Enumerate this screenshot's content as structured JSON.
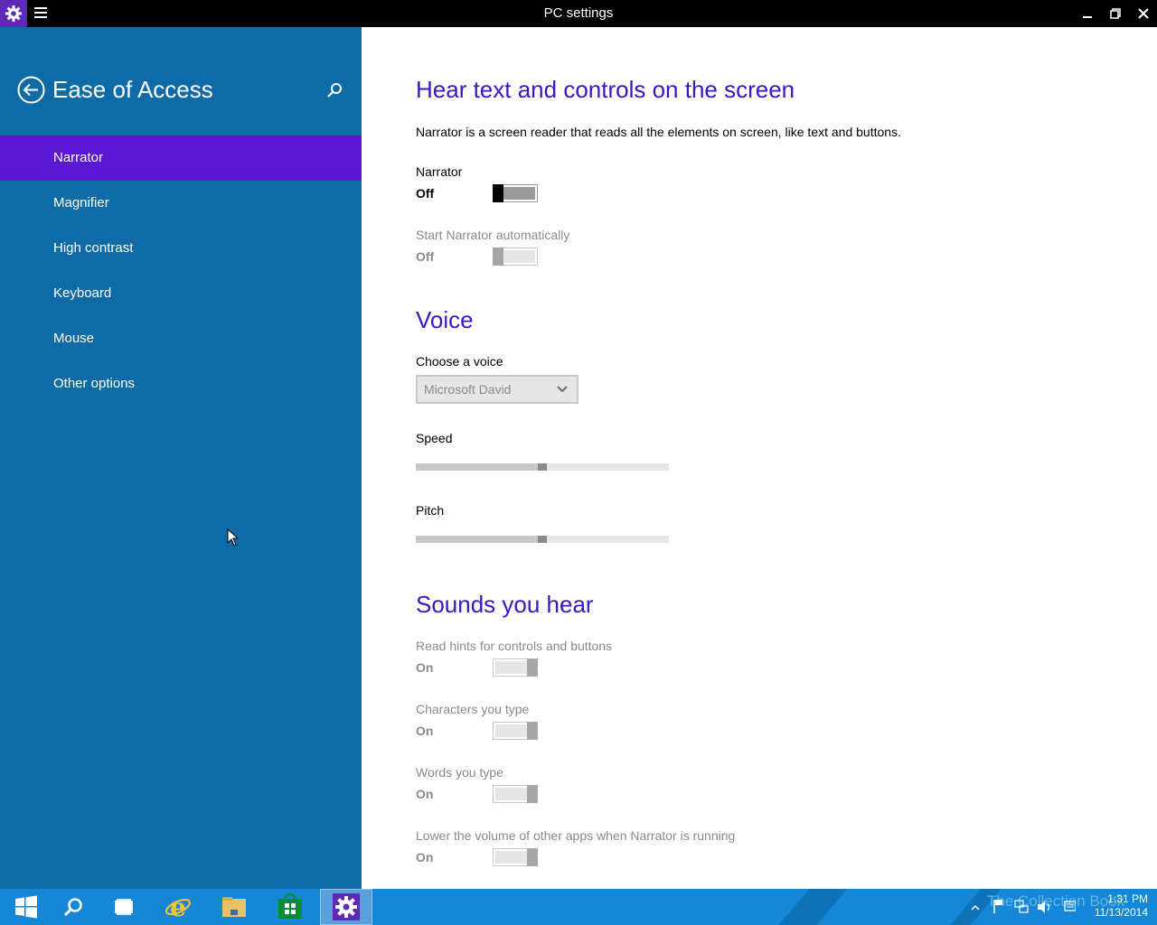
{
  "window": {
    "title": "PC settings",
    "icons": {
      "app": "gear-icon",
      "menu": "hamburger-icon",
      "minimize": "minimize-icon",
      "maximize": "restore-icon",
      "close": "close-icon"
    }
  },
  "sidebar": {
    "title": "Ease of Access",
    "back_icon": "back-arrow-icon",
    "search_icon": "search-icon",
    "items": [
      {
        "label": "Narrator",
        "selected": true
      },
      {
        "label": "Magnifier"
      },
      {
        "label": "High contrast"
      },
      {
        "label": "Keyboard"
      },
      {
        "label": "Mouse"
      },
      {
        "label": "Other options"
      }
    ]
  },
  "main": {
    "hear_section": {
      "heading": "Hear text and controls on the screen",
      "description": "Narrator is a screen reader that reads all the elements on screen, like text and buttons.",
      "narrator": {
        "label": "Narrator",
        "state": "Off"
      },
      "start_auto": {
        "label": "Start Narrator automatically",
        "state": "Off"
      }
    },
    "voice_section": {
      "heading": "Voice",
      "choose_voice_label": "Choose a voice",
      "voice_value": "Microsoft David",
      "speed_label": "Speed",
      "speed_value": 0.5,
      "pitch_label": "Pitch",
      "pitch_value": 0.5
    },
    "sounds_section": {
      "heading": "Sounds you hear",
      "read_hints": {
        "label": "Read hints for controls and buttons",
        "state": "On"
      },
      "characters": {
        "label": "Characters you type",
        "state": "On"
      },
      "words": {
        "label": "Words you type",
        "state": "On"
      },
      "lower_volume": {
        "label": "Lower the volume of other apps when Narrator is running",
        "state": "On"
      }
    }
  },
  "taskbar": {
    "items": [
      "start-icon",
      "search-icon",
      "task-view-icon",
      "internet-explorer-icon",
      "file-explorer-icon",
      "store-icon",
      "pc-settings-icon"
    ],
    "watermark": "The Collection Book",
    "clock_time": "1:31 PM",
    "clock_date": "11/13/2014"
  },
  "colors": {
    "sidebar": "#0f6ba5",
    "selected": "#5b19d6",
    "heading": "#3e15c4",
    "taskbar": "#1587d6"
  }
}
